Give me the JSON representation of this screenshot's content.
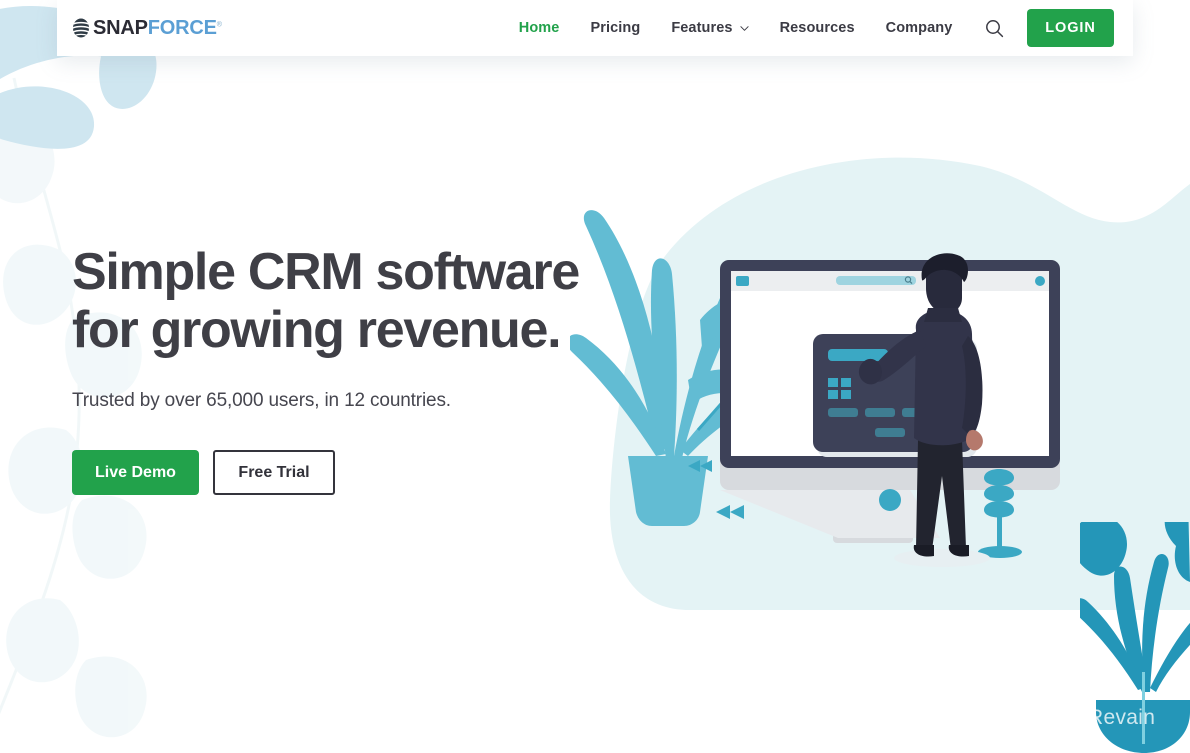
{
  "brand": {
    "name_part1": "SNAP",
    "name_part2": "FORCE",
    "trademark": "®",
    "icon": "globe-stripes-icon"
  },
  "header": {
    "nav": [
      {
        "label": "Home",
        "active": true,
        "has_chevron": false,
        "icon": ""
      },
      {
        "label": "Pricing",
        "active": false,
        "has_chevron": false,
        "icon": ""
      },
      {
        "label": "Features",
        "active": false,
        "has_chevron": true,
        "icon": "chevron-down-icon"
      },
      {
        "label": "Resources",
        "active": false,
        "has_chevron": false,
        "icon": ""
      },
      {
        "label": "Company",
        "active": false,
        "has_chevron": false,
        "icon": ""
      }
    ],
    "search_icon": "search-icon",
    "login_label": "LOGIN"
  },
  "hero": {
    "title_line1": "Simple CRM software",
    "title_line2": "for growing revenue.",
    "subtitle": "Trusted by over 65,000 users, in 12 countries.",
    "primary_cta": "Live Demo",
    "secondary_cta": "Free Trial"
  },
  "illustration": {
    "name": "man-at-desktop-monitor-illustration",
    "elements": [
      "background-blob",
      "left-plant",
      "desktop-monitor",
      "browser-window",
      "dashboard-card",
      "standing-man",
      "small-tree",
      "bowtie-accents",
      "pin-accent"
    ]
  },
  "watermark": {
    "label": "Revain",
    "icon": "revain-logo-icon"
  },
  "colors": {
    "accent_green": "#22a24b",
    "brand_blue": "#5b9fd4",
    "teal": "#3ba8c4",
    "teal_light": "#62bcd3",
    "mint_blob": "#e4f3f5",
    "navy": "#3d4158",
    "navy_dark": "#2f3142",
    "heading": "#3f3f46",
    "pale_leaf": "#cfe7ef"
  }
}
